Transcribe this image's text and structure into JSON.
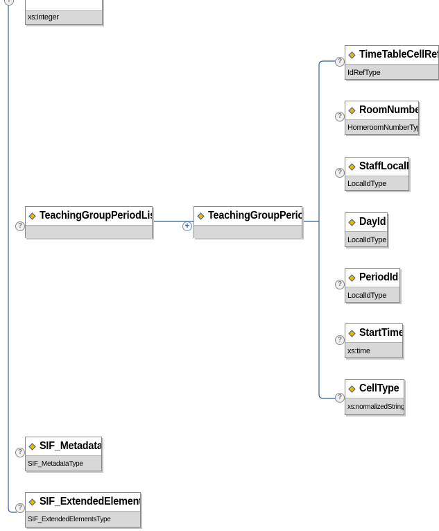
{
  "top_partial": {
    "type": "xs:integer"
  },
  "parent": {
    "name": "TeachingGroupPeriodList",
    "type": ""
  },
  "child": {
    "name": "TeachingGroupPeriod",
    "type": ""
  },
  "elements": [
    {
      "name": "TimeTableCellRefId",
      "type": "IdRefType"
    },
    {
      "name": "RoomNumber",
      "type": "HomeroomNumberType"
    },
    {
      "name": "StaffLocalId",
      "type": "LocalIdType"
    },
    {
      "name": "DayId",
      "type": "LocalIdType"
    },
    {
      "name": "PeriodId",
      "type": "LocalIdType"
    },
    {
      "name": "StartTime",
      "type": "xs:time"
    },
    {
      "name": "CellType",
      "type": "xs:normalizedString"
    }
  ],
  "bottom": [
    {
      "name": "SIF_Metadata",
      "type": "SIF_MetadataType"
    },
    {
      "name": "SIF_ExtendedElements",
      "type": "SIF_ExtendedElementsType"
    }
  ],
  "symbols": {
    "optional": "?",
    "expand": "+"
  },
  "colors": {
    "connector": "#2f5f9f",
    "type_band": "#d8d8d8",
    "border": "#8a8a8a"
  }
}
